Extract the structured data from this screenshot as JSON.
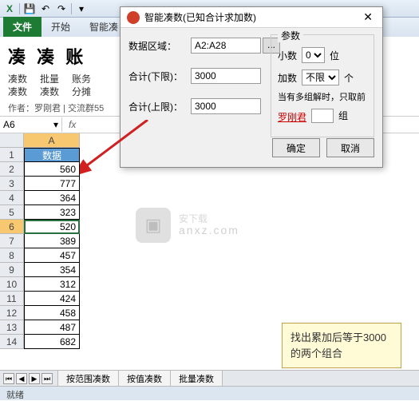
{
  "qat": {
    "excel": "X"
  },
  "tabs": {
    "file": "文件",
    "home": "开始",
    "addin": "智能凑"
  },
  "logo": {
    "title": "凑 凑 账",
    "cols": [
      [
        "凑数",
        "凑数"
      ],
      [
        "批量",
        "凑数"
      ],
      [
        "账务",
        "分摊"
      ]
    ],
    "author": "作者：罗刚君 | 交流群55"
  },
  "namebox": {
    "ref": "A6",
    "fx": "fx"
  },
  "colA": "A",
  "header_cell": "数据",
  "rows": [
    {
      "n": "1",
      "v": "数据",
      "hdr": true
    },
    {
      "n": "2",
      "v": "560"
    },
    {
      "n": "3",
      "v": "777"
    },
    {
      "n": "4",
      "v": "364"
    },
    {
      "n": "5",
      "v": "323"
    },
    {
      "n": "6",
      "v": "520",
      "active": true
    },
    {
      "n": "7",
      "v": "389"
    },
    {
      "n": "8",
      "v": "457"
    },
    {
      "n": "9",
      "v": "354"
    },
    {
      "n": "10",
      "v": "312"
    },
    {
      "n": "11",
      "v": "424"
    },
    {
      "n": "12",
      "v": "458"
    },
    {
      "n": "13",
      "v": "487"
    },
    {
      "n": "14",
      "v": "682"
    }
  ],
  "dialog": {
    "title": "智能凑数(已知合计求加数)",
    "range_label": "数据区域：",
    "range_value": "A2:A28",
    "range_btn": "...",
    "lower_label": "合计(下限)：",
    "lower_value": "3000",
    "upper_label": "合计(上限)：",
    "upper_value": "3000",
    "params_title": "参数",
    "decimals_label": "小数",
    "decimals_value": "0",
    "decimals_unit": "位",
    "addend_label": "加数",
    "addend_value": "不限",
    "addend_unit": "个",
    "note": "当有多组解时，只取前",
    "groups_value": "",
    "groups_unit": "组",
    "link": "罗刚君",
    "ok": "确定",
    "cancel": "取消"
  },
  "callout": "找出累加后等于3000的两个组合",
  "sheets": [
    "按范围凑数",
    "按值凑数",
    "批量凑数"
  ],
  "status": "就绪",
  "watermark": {
    "main": "安下载",
    "sub": "anxz.com"
  }
}
